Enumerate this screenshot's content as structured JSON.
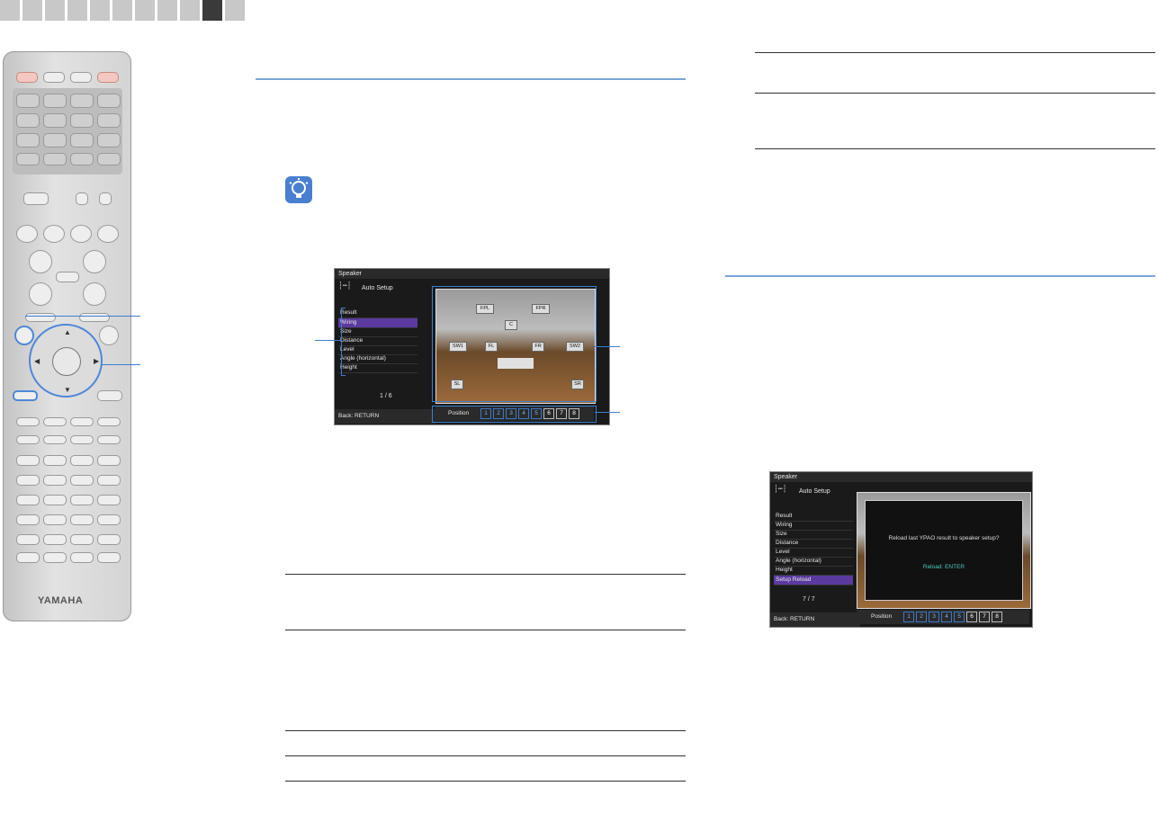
{
  "tabs": {
    "count": 11,
    "active_index": 9
  },
  "remote": {
    "brand": "YAMAHA"
  },
  "screen1": {
    "title": "Speaker",
    "subtitle": "Auto Setup",
    "menu": [
      "Result",
      "Wiring",
      "Size",
      "Distance",
      "Level",
      "Angle (horizontal)",
      "Height"
    ],
    "selected": "Wiring",
    "page": "1 / 6",
    "back": "Back: RETURN",
    "position_label": "Position",
    "positions": [
      "1",
      "2",
      "3",
      "4",
      "5",
      "6",
      "7",
      "8"
    ],
    "speakers": [
      "FPL",
      "FPR",
      "C",
      "SW1",
      "FL",
      "FR",
      "SW2",
      "SL",
      "SR"
    ]
  },
  "screen2": {
    "title": "Speaker",
    "subtitle": "Auto Setup",
    "menu": [
      "Result",
      "Wiring",
      "Size",
      "Distance",
      "Level",
      "Angle (horizontal)",
      "Height",
      "Setup Reload"
    ],
    "selected": "Setup Reload",
    "page": "7 / 7",
    "back": "Back: RETURN",
    "position_label": "Position",
    "positions": [
      "1",
      "2",
      "3",
      "4",
      "5",
      "6",
      "7",
      "8"
    ],
    "dialog_message": "Reload last YPAO result to speaker setup?",
    "dialog_action": "Reload: ENTER"
  },
  "colors": {
    "accent_blue": "#3c7fd1",
    "menu_highlight": "#5b3aa0",
    "dialog_text": "#4fc8c0"
  }
}
